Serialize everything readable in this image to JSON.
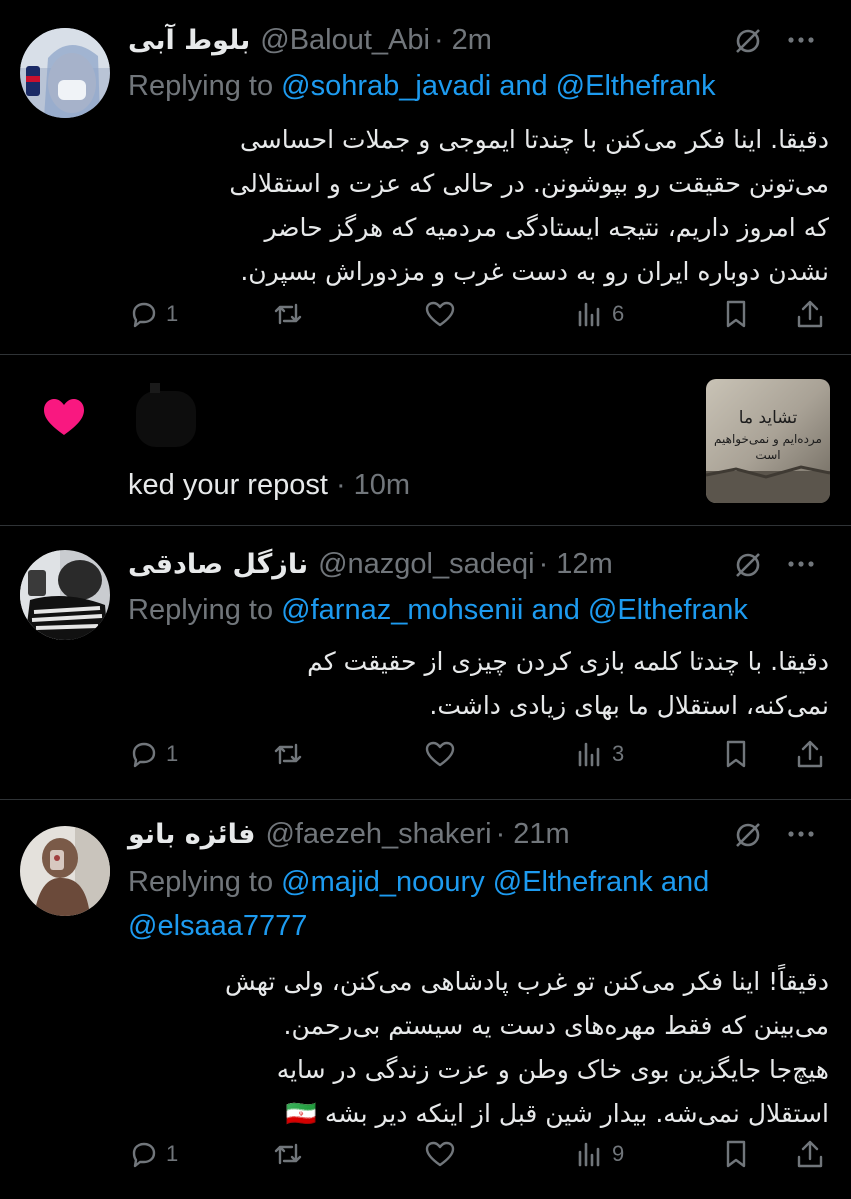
{
  "tweets": [
    {
      "display_name": "بلوط آبی",
      "handle": "@Balout_Abi",
      "time": "· 2m",
      "reply_prefix": "Replying to ",
      "reply_mentions": [
        "@sohrab_javadi",
        " and ",
        "@Elthefrank"
      ],
      "body": "دقیقا. اینا فکر می‌کنن با چندتا ایموجی و جملات احساسی\nمی‌تونن حقیقت رو بپوشونن. در حالی که عزت و استقلالی\nکه امروز داریم، نتیجه ایستادگی مردمیه که هرگز حاضر\nنشدن دوباره ایران رو به دست غرب و مزدوراش بسپرن.",
      "replies": "1",
      "views": "6"
    },
    {
      "display_name": "نازگل صادقی",
      "handle": "@nazgol_sadeqi",
      "time": "· 12m",
      "reply_prefix": "Replying to ",
      "reply_mentions": [
        "@farnaz_mohsenii",
        " and ",
        "@Elthefrank"
      ],
      "body": "دقیقا. با چندتا کلمه بازی کردن چیزی از حقیقت کم\nنمی‌کنه، استقلال ما بهای زیادی داشت.",
      "replies": "1",
      "views": "3"
    },
    {
      "display_name": "فائزه بانو",
      "handle": "@faezeh_shakeri",
      "time": "· 21m",
      "reply_prefix": "Replying to ",
      "reply_line1": [
        "@majid_nooury",
        " ",
        "@Elthefrank",
        " and"
      ],
      "reply_line2": "@elsaaa7777",
      "body": "دقیقاً! اینا فکر می‌کنن تو غرب پادشاهی می‌کنن، ولی تهش\nمی‌بینن که فقط مهره‌های دست یه سیستم بی‌رحمن.\nهیچ‌جا جایگزین بوی خاک وطن و عزت زندگی در سایه\nاستقلال نمی‌شه. بیدار شین قبل از اینکه دیر بشه 🇮🇷",
      "replies": "1",
      "views": "9"
    }
  ],
  "notification": {
    "text": "ked your repost",
    "time": "· 10m",
    "thumb_text": "تشاید ما مرده‌ایم و نمی‌خواهیم است"
  },
  "colors": {
    "background": "#000000",
    "text": "#e7e9ea",
    "muted": "#71767b",
    "link": "#1d9bf0",
    "like": "#f91880",
    "divider": "#2f3336"
  },
  "icons": [
    "reply-icon",
    "repost-icon",
    "like-icon",
    "views-icon",
    "bookmark-icon",
    "share-icon",
    "grok-icon",
    "more-icon",
    "heart-icon"
  ]
}
